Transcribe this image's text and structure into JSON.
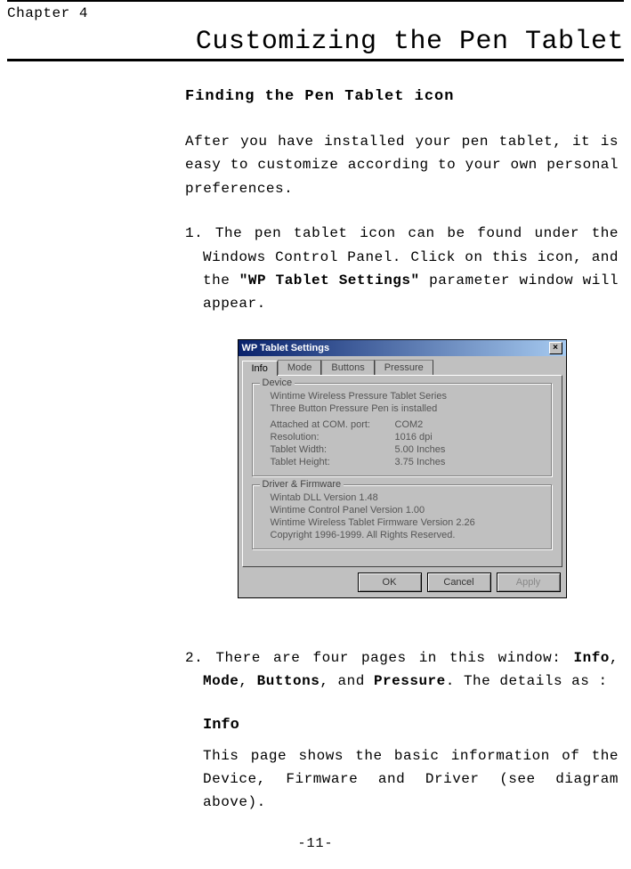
{
  "chapter_label": "Chapter 4",
  "chapter_title": "Customizing the Pen Tablet",
  "h_finding": "Finding the Pen Tablet icon",
  "p_intro": "After you have installed your pen tablet, it is easy to customize according to your own personal preferences.",
  "li1_pre": "1. The pen tablet icon can be found under the Windows Control Panel.  Click on this icon, and the ",
  "li1_bold": "\"WP Tablet Settings\"",
  "li1_post": " parameter window will appear.",
  "li2_pre": "2. There are four pages in this window: ",
  "li2_b1": "Info",
  "li2_sep1": ", ",
  "li2_b2": "Mode",
  "li2_sep2": ", ",
  "li2_b3": "Buttons",
  "li2_sep3": ", and ",
  "li2_b4": "Pressure",
  "li2_post": ".  The details as :",
  "h_info": "Info",
  "p_info": "This page shows the basic information of the Device, Firmware and Driver (see diagram above).",
  "page_number": "-11-",
  "dialog": {
    "title": "WP Tablet Settings",
    "close": "×",
    "tabs": {
      "t1": "Info",
      "t2": "Mode",
      "t3": "Buttons",
      "t4": "Pressure"
    },
    "device": {
      "legend": "Device",
      "l1": "Wintime Wireless Pressure Tablet Series",
      "l2": "Three Button Pressure Pen is installed",
      "r1l": "Attached at COM. port:",
      "r1v": "COM2",
      "r2l": "Resolution:",
      "r2v": "1016 dpi",
      "r3l": "Tablet Width:",
      "r3v": "5.00 Inches",
      "r4l": "Tablet Height:",
      "r4v": "3.75 Inches"
    },
    "drv": {
      "legend": "Driver & Firmware",
      "l1": "Wintab DLL Version 1.48",
      "l2": "Wintime Control Panel Version 1.00",
      "l3": "Wintime Wireless Tablet Firmware Version 2.26",
      "l4": "Copyright 1996-1999. All Rights Reserved."
    },
    "btns": {
      "ok": "OK",
      "cancel": "Cancel",
      "apply": "Apply"
    }
  }
}
